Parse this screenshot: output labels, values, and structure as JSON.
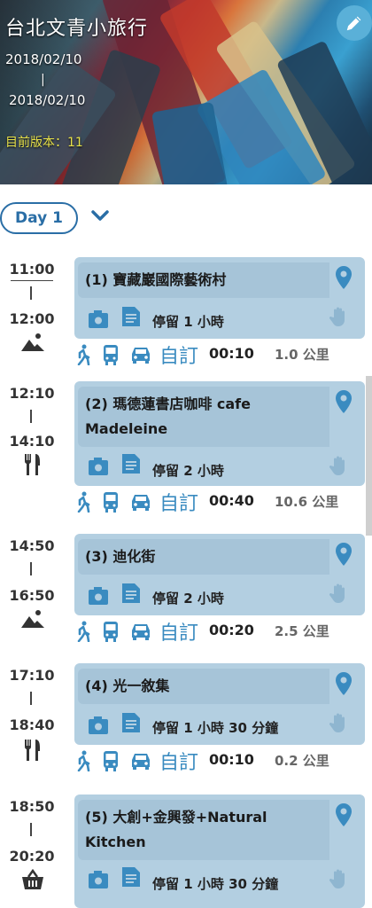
{
  "header": {
    "title": "台北文青小旅行",
    "start_date": "2018/02/10",
    "separator": "|",
    "end_date": "2018/02/10",
    "version": "目前版本：11"
  },
  "day": {
    "label": "Day 1"
  },
  "stops": [
    {
      "start": "11:00",
      "end": "12:00",
      "icon": "mountain-icon",
      "name": "(1) 寶藏巖國際藝術村",
      "stay": "停留 1 小時",
      "route": {
        "mode": "自訂",
        "time": "00:10",
        "distance": "1.0 公里"
      }
    },
    {
      "start": "12:10",
      "end": "14:10",
      "icon": "utensils-icon",
      "name": "(2) 瑪德蓮書店咖啡 cafe Madeleine",
      "stay": "停留 2 小時",
      "route": {
        "mode": "自訂",
        "time": "00:40",
        "distance": "10.6 公里"
      }
    },
    {
      "start": "14:50",
      "end": "16:50",
      "icon": "mountain-icon",
      "name": "(3) 迪化街",
      "stay": "停留 2 小時",
      "route": {
        "mode": "自訂",
        "time": "00:20",
        "distance": "2.5 公里"
      }
    },
    {
      "start": "17:10",
      "end": "18:40",
      "icon": "utensils-icon",
      "name": "(4) 光一敘集",
      "stay": "停留 1 小時 30 分鐘",
      "route": {
        "mode": "自訂",
        "time": "00:10",
        "distance": "0.2 公里"
      }
    },
    {
      "start": "18:50",
      "end": "20:20",
      "icon": "shopping-basket-icon",
      "name": "(5) 大創+金興發+Natural Kitchen",
      "stay": "停留 1 小時 30 分鐘"
    }
  ],
  "colors": {
    "accent": "#2a6ea6",
    "card": "#b3cfe1",
    "icon": "#3a8bc0",
    "version": "#e8e24a"
  }
}
